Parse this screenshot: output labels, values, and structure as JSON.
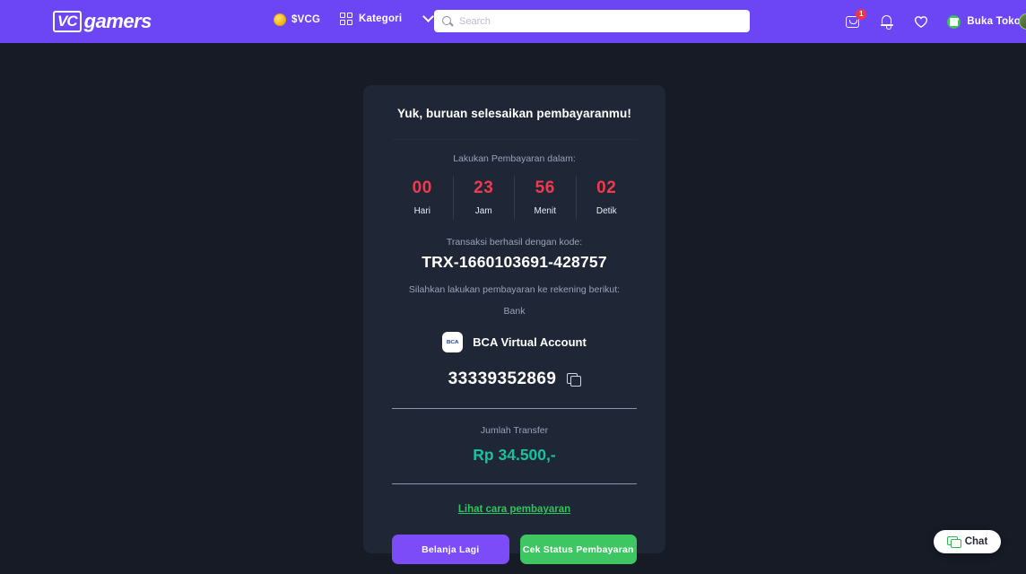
{
  "header": {
    "logo_badge": "VC",
    "logo_word": "gamers",
    "vcg_label": "$VCG",
    "vcg_icon": "coin-icon",
    "kategori_label": "Kategori",
    "kategori_icon": "grid-icon",
    "chevron_icon": "chevron-down-icon",
    "search_placeholder": "Search",
    "search_value": "",
    "search_icon": "search-icon",
    "cart_icon": "cart-icon",
    "cart_badge": "1",
    "bell_icon": "bell-icon",
    "wishlist_icon": "heart-icon",
    "store_icon": "store-icon",
    "store_label": "Buka Toko",
    "avatar_icon": "avatar"
  },
  "card": {
    "title": "Yuk, buruan selesaikan pembayaranmu!",
    "countdown_label": "Lakukan Pembayaran dalam:",
    "countdown": [
      {
        "value": "00",
        "unit": "Hari"
      },
      {
        "value": "23",
        "unit": "Jam"
      },
      {
        "value": "56",
        "unit": "Menit"
      },
      {
        "value": "02",
        "unit": "Detik"
      }
    ],
    "trx_label": "Transaksi berhasil dengan kode:",
    "trx_code": "TRX-1660103691-428757",
    "pay_instruction": "Silahkan lakukan pembayaran ke rekening berikut:",
    "bank_label": "Bank",
    "bank_logo_text": "BCA",
    "bank_name": "BCA Virtual Account",
    "account_number": "33339352869",
    "copy_icon": "copy-icon",
    "amount_label": "Jumlah Transfer",
    "amount_value": "Rp 34.500,-",
    "howto_link": "Lihat cara pembayaran",
    "btn_shop_again": "Belanja Lagi",
    "btn_check_status": "Cek Status Pembayaran"
  },
  "chat": {
    "label": "Chat",
    "icon": "chat-bubble-icon"
  },
  "colors": {
    "header_purple": "#6c45f5",
    "page_bg": "#161b26",
    "card_bg": "#1f2636",
    "countdown_red": "#ef3a50",
    "amount_teal": "#18c2a0",
    "link_green": "#2fc55a",
    "btn_purple": "#7b4cf7",
    "btn_green": "#3ec662",
    "badge_red": "#f03448"
  }
}
